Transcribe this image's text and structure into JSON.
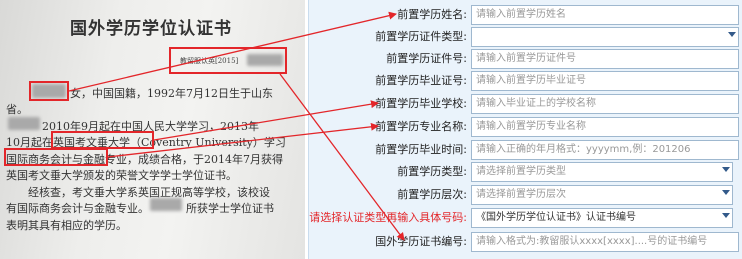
{
  "certificate": {
    "title": "国外学历学位认证书",
    "ref_no": "教留服认英[2015]",
    "lines": [
      "女，中国国籍，1992年7月12日生于山东",
      "省。",
      "2010年9月起在中国人民大学学习，2013年",
      "10月起在英国考文垂大学（Coventry University）学习",
      "国际商务会计与金融专业，成绩合格，于2014年7月获得",
      "英国考文垂大学颁发的荣誉文学学士学位证书。",
      "经核查，考文垂大学系英国正规高等学校，该校设",
      "有国际商务会计与金融专业。",
      "所获学士学位证书",
      "表明其具有相应的学历。"
    ]
  },
  "form": {
    "rows": [
      {
        "label": "前置学历姓名:",
        "placeholder": "请输入前置学历姓名"
      },
      {
        "label": "前置学历证件类型:",
        "value": ""
      },
      {
        "label": "前置学历证件号:",
        "placeholder": "请输入前置学历证件号"
      },
      {
        "label": "前置学历毕业证号:",
        "placeholder": "请输入前置学历毕业证号"
      },
      {
        "label": "前置学历毕业学校:",
        "placeholder": "请输入毕业证上的学校名称"
      },
      {
        "label": "前置学历专业名称:",
        "placeholder": "请输入前置学历专业名称"
      },
      {
        "label": "前置学历毕业时间:",
        "placeholder": "请输入正确的年月格式：yyyymm,例：201206"
      },
      {
        "label": "前置学历类型:",
        "placeholder": "请选择前置学历类型"
      },
      {
        "label": "前置学历层次:",
        "placeholder": "请选择前置学历层次"
      },
      {
        "label": "请选择认证类型再输入具体号码:",
        "value": "《国外学历学位认证书》认证书编号"
      },
      {
        "label": "国外学历证书编号:",
        "placeholder": "请输入格式为:教留服认xxxx[xxxx]....号的证书编号"
      }
    ]
  },
  "colors": {
    "accent_red": "#e3262a",
    "form_bg": "#eaf3fb",
    "field_border": "#9fb8cf"
  }
}
